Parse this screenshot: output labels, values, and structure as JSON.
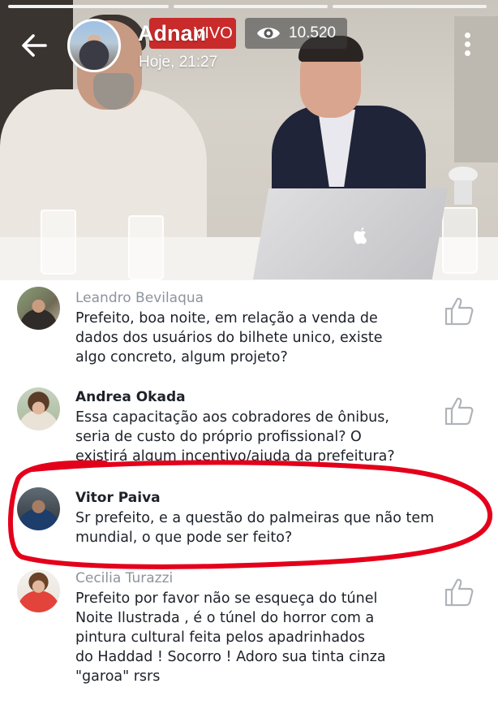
{
  "header": {
    "host_name": "Adnan",
    "timestamp": "Hoje, 21:27",
    "live_label": "VIVO",
    "viewer_count": "10.520"
  },
  "icons": {
    "back": "arrow-left",
    "viewers": "eye",
    "menu": "more-vertical",
    "like": "thumbs-up-outline",
    "laptop_logo": "apple-logo"
  },
  "colors": {
    "live_badge": "#c92a2a",
    "highlight_circle": "#e4001b",
    "name_text": "#1d2129",
    "faded_name": "#8d949e"
  },
  "comments": [
    {
      "author": "Leandro Bevilaqua",
      "lines": [
        "Prefeito, boa noite, em relação a venda de",
        "dados dos usuários do bilhete unico, existe",
        "algo concreto, algum projeto?"
      ]
    },
    {
      "author": "Andrea Okada",
      "lines": [
        "Essa capacitação aos cobradores de ônibus,",
        "seria de custo do próprio profissional? O",
        "existirá algum incentivo/ajuda da prefeitura?"
      ]
    },
    {
      "author": "Vitor Paiva",
      "lines": [
        "Sr prefeito, e a questão do palmeiras que não tem",
        "mundial, o que pode ser feito?"
      ]
    },
    {
      "author": "Cecilia Turazzi",
      "lines": [
        "Prefeito por favor não se esqueça do túnel",
        "Noite Ilustrada , é o túnel do horror com a",
        "pintura cultural feita pelos apadrinhados",
        "do Haddad ! Socorro ! Adoro sua tinta cinza",
        "\"garoa\" rsrs"
      ]
    }
  ]
}
